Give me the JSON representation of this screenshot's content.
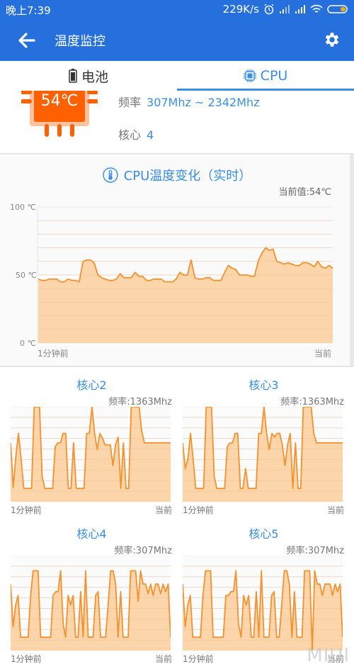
{
  "status_bar": {
    "time": "晚上7:39",
    "net_speed": "229K/s",
    "icons": [
      "alarm-icon",
      "signal-icon",
      "signal-icon",
      "wifi-icon",
      "battery-icon"
    ]
  },
  "app_bar": {
    "title": "温度监控",
    "back_icon": "arrow-left-icon",
    "settings_icon": "gear-icon"
  },
  "tabs": [
    {
      "label": "电池",
      "icon": "battery-icon",
      "active": false
    },
    {
      "label": "CPU",
      "icon": "chip-icon",
      "active": true
    }
  ],
  "cpu_info": {
    "temperature": "54℃",
    "freq_label": "频率",
    "freq_value": "307Mhz ~ 2342Mhz",
    "cores_label": "核心",
    "cores_value": "4"
  },
  "colors": {
    "primary": "#2670de",
    "accent": "#3a8ee6",
    "chip_orange": "#ff6000",
    "line_orange": "#f5922f",
    "fill_orange": "#fcd3a5"
  },
  "main_chart": {
    "title": "CPU温度变化（实时）",
    "current_label": "当前值:54℃",
    "x_left": "1分钟前",
    "x_right": "当前"
  },
  "cores": [
    {
      "title": "核心2",
      "freq": "频率:1363Mhz",
      "x_left": "1分钟前",
      "x_right": "当前"
    },
    {
      "title": "核心3",
      "freq": "频率:1363Mhz",
      "x_left": "1分钟前",
      "x_right": "当前"
    },
    {
      "title": "核心4",
      "freq": "频率:307Mhz",
      "x_left": "1分钟前",
      "x_right": "当前"
    },
    {
      "title": "核心5",
      "freq": "频率:307Mhz",
      "x_left": "1分钟前",
      "x_right": "当前"
    }
  ],
  "watermark": "MIUI",
  "chart_data": [
    {
      "type": "area",
      "title": "CPU温度变化（实时）",
      "xlabel": "",
      "ylabel": "",
      "x_tick_labels": [
        "1分钟前",
        "当前"
      ],
      "y_tick_labels": [
        "0 ℃",
        "50 ℃",
        "100 ℃"
      ],
      "ylim": [
        0,
        100
      ],
      "grid": true,
      "values": [
        47,
        46,
        46,
        47,
        47,
        47,
        45,
        45,
        47,
        46,
        46,
        45,
        60,
        61,
        61,
        59,
        50,
        48,
        47,
        46,
        46,
        47,
        51,
        48,
        48,
        48,
        52,
        49,
        49,
        46,
        46,
        47,
        47,
        47,
        45,
        45,
        45,
        47,
        52,
        50,
        50,
        61,
        48,
        47,
        47,
        48,
        48,
        46,
        46,
        46,
        52,
        57,
        55,
        54,
        50,
        50,
        50,
        49,
        49,
        60,
        66,
        70,
        68,
        69,
        60,
        59,
        58,
        59,
        58,
        57,
        57,
        59,
        59,
        58,
        56,
        60,
        56,
        55,
        57,
        55
      ]
    },
    {
      "type": "area",
      "title": "核心2",
      "x_tick_labels": [
        "1分钟前",
        "当前"
      ],
      "ylim": [
        0,
        100
      ],
      "grid": true,
      "values": [
        62,
        15,
        48,
        72,
        45,
        14,
        14,
        14,
        14,
        100,
        100,
        100,
        27,
        14,
        14,
        14,
        14,
        58,
        62,
        62,
        72,
        72,
        14,
        14,
        62,
        14,
        14,
        14,
        14,
        72,
        72,
        100,
        72,
        55,
        72,
        67,
        60,
        60,
        60,
        38,
        60,
        68,
        14,
        62,
        14,
        14,
        100,
        100,
        100,
        100,
        74,
        62,
        62,
        62,
        62,
        62,
        62,
        62,
        62,
        62,
        62,
        62
      ]
    },
    {
      "type": "area",
      "title": "核心3",
      "x_tick_labels": [
        "1分钟前",
        "当前"
      ],
      "ylim": [
        0,
        100
      ],
      "grid": true,
      "values": [
        62,
        35,
        45,
        72,
        45,
        14,
        14,
        14,
        14,
        100,
        100,
        100,
        27,
        14,
        14,
        14,
        14,
        58,
        62,
        62,
        72,
        72,
        14,
        14,
        35,
        14,
        14,
        14,
        14,
        72,
        72,
        100,
        72,
        55,
        72,
        68,
        72,
        72,
        60,
        38,
        60,
        72,
        14,
        62,
        14,
        14,
        100,
        100,
        100,
        100,
        72,
        62,
        62,
        62,
        62,
        62,
        62,
        62,
        62,
        62,
        62,
        62
      ]
    },
    {
      "type": "area",
      "title": "核心4",
      "x_tick_labels": [
        "1分钟前",
        "当前"
      ],
      "ylim": [
        0,
        100
      ],
      "grid": true,
      "values": [
        70,
        25,
        48,
        58,
        14,
        14,
        14,
        14,
        58,
        84,
        84,
        84,
        14,
        14,
        14,
        14,
        14,
        58,
        62,
        62,
        84,
        28,
        14,
        58,
        48,
        58,
        14,
        14,
        62,
        14,
        84,
        14,
        14,
        14,
        58,
        62,
        14,
        14,
        14,
        48,
        84,
        84,
        70,
        14,
        62,
        14,
        14,
        14,
        84,
        84,
        84,
        52,
        84,
        70,
        70,
        60,
        70,
        58,
        70,
        70,
        60,
        70,
        62,
        70,
        14
      ]
    },
    {
      "type": "area",
      "title": "核心5",
      "x_tick_labels": [
        "1分钟前",
        "当前"
      ],
      "ylim": [
        0,
        100
      ],
      "grid": true,
      "values": [
        70,
        25,
        48,
        58,
        14,
        14,
        14,
        14,
        58,
        84,
        84,
        84,
        14,
        14,
        14,
        14,
        14,
        58,
        58,
        62,
        62,
        84,
        28,
        14,
        58,
        48,
        58,
        14,
        14,
        62,
        14,
        84,
        14,
        14,
        14,
        58,
        62,
        14,
        14,
        48,
        84,
        84,
        70,
        14,
        62,
        14,
        14,
        14,
        84,
        84,
        84,
        0,
        84,
        70,
        70,
        58,
        70,
        70,
        70,
        58,
        70,
        62,
        70,
        14
      ]
    }
  ]
}
